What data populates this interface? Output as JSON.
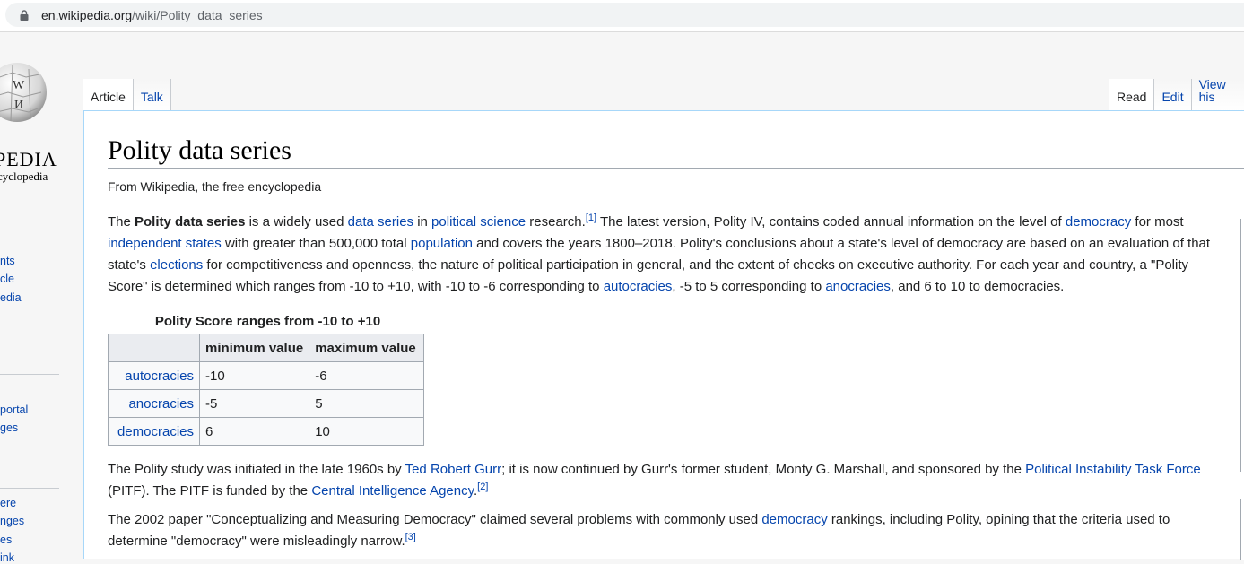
{
  "browser": {
    "url_host": "en.wikipedia.org",
    "url_path": "/wiki/Polity_data_series"
  },
  "sidebar": {
    "logo_word": "PEDIA",
    "logo_tagline": "cyclopedia",
    "logo_glyphs": [
      "W",
      "И"
    ],
    "links_group1": [
      "nts",
      "cle",
      "edia"
    ],
    "links_group2": [
      "portal",
      "ges"
    ],
    "links_group3": [
      "ere",
      "nges",
      "es",
      "ink"
    ]
  },
  "tabs": {
    "left": [
      "Article",
      "Talk"
    ],
    "right": [
      "Read",
      "Edit",
      "View his"
    ]
  },
  "article": {
    "title": "Polity data series",
    "tagline": "From Wikipedia, the free encyclopedia",
    "p1": {
      "t1": "The ",
      "b1": "Polity data series",
      "t2": " is a widely used ",
      "l1": "data series",
      "t3": " in ",
      "l2": "political science",
      "t4": " research.",
      "s1": "[1]",
      "t5": " The latest version, Polity IV, contains coded annual information on the level of ",
      "l3": "democracy",
      "t6": " for most ",
      "l4": "independent states",
      "t7": " with greater than 500,000 total ",
      "l5": "population",
      "t8": " and covers the years 1800–2018. Polity's conclusions about a state's level of democracy are based on an evaluation of that state's ",
      "l6": "elections",
      "t9": " for competitiveness and openness, the nature of political participation in general, and the extent of checks on executive authority. For each year and country, a \"Polity Score\" is determined which ranges from -10 to +10, with -10 to -6 corresponding to ",
      "l7": "autocracies",
      "t10": ", -5 to 5 corresponding to ",
      "l8": "anocracies",
      "t11": ", and 6 to 10 to democracies."
    },
    "table": {
      "caption": "Polity Score ranges from -10 to +10",
      "headers": [
        "",
        "minimum value",
        "maximum value"
      ],
      "rows": [
        {
          "label": "autocracies",
          "min": "-10",
          "max": "-6"
        },
        {
          "label": "anocracies",
          "min": "-5",
          "max": "5"
        },
        {
          "label": "democracies",
          "min": "6",
          "max": "10"
        }
      ]
    },
    "p2": {
      "t1": "The Polity study was initiated in the late 1960s by ",
      "l1": "Ted Robert Gurr",
      "t2": "; it is now continued by Gurr's former student, Monty G. Marshall, and sponsored by the ",
      "l2": "Political Instability Task Force",
      "t3": " (PITF). The PITF is funded by the ",
      "l3": "Central Intelligence Agency",
      "t4": ".",
      "s1": "[2]"
    },
    "p3": {
      "t1": "The 2002 paper \"Conceptualizing and Measuring Democracy\" claimed several problems with commonly used ",
      "l1": "democracy",
      "t2": " rankings, including Polity, opining that the criteria used to determine \"democracy\" were misleadingly narrow.",
      "s1": "[3]"
    }
  }
}
